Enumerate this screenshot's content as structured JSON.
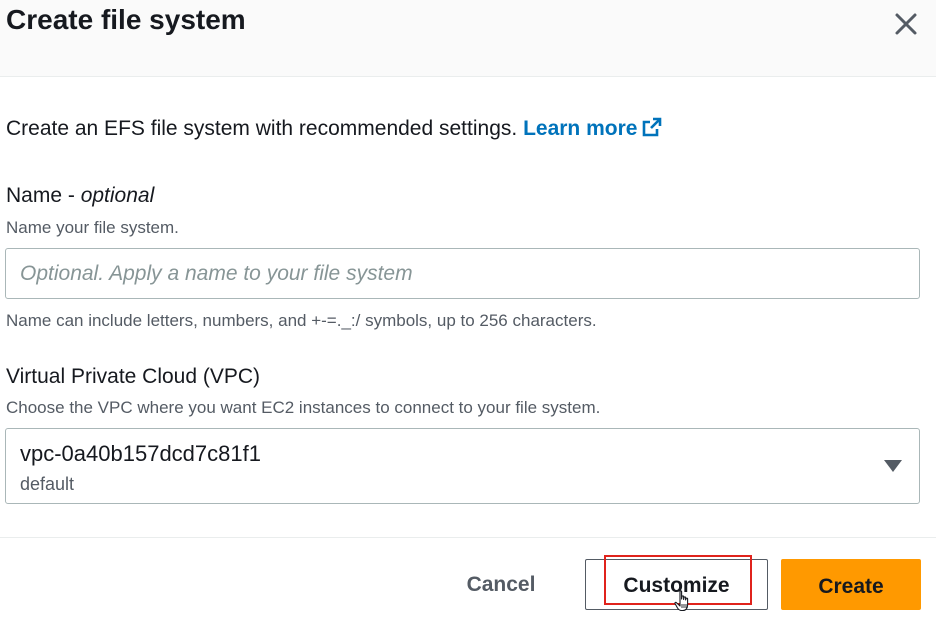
{
  "modal": {
    "title": "Create file system",
    "close_icon": "close-icon"
  },
  "intro": {
    "text": "Create an EFS file system with recommended settings.",
    "link_label": "Learn more",
    "link_icon": "external-link-icon"
  },
  "name_field": {
    "label": "Name - ",
    "label_optional": "optional",
    "description": "Name your file system.",
    "value": "",
    "placeholder": "Optional. Apply a name to your file system",
    "constraint": "Name can include letters, numbers, and +-=._:/ symbols, up to 256 characters."
  },
  "vpc_field": {
    "label": "Virtual Private Cloud (VPC)",
    "description": "Choose the VPC where you want EC2 instances to connect to your file system.",
    "selected_value": "vpc-0a40b157dcd7c81f1",
    "selected_sublabel": "default",
    "caret_icon": "caret-down-icon"
  },
  "footer": {
    "cancel_label": "Cancel",
    "customize_label": "Customize",
    "create_label": "Create"
  },
  "colors": {
    "primary_button": "#ff9900",
    "link": "#0073bb",
    "highlight_annotation": "#e0231c"
  }
}
